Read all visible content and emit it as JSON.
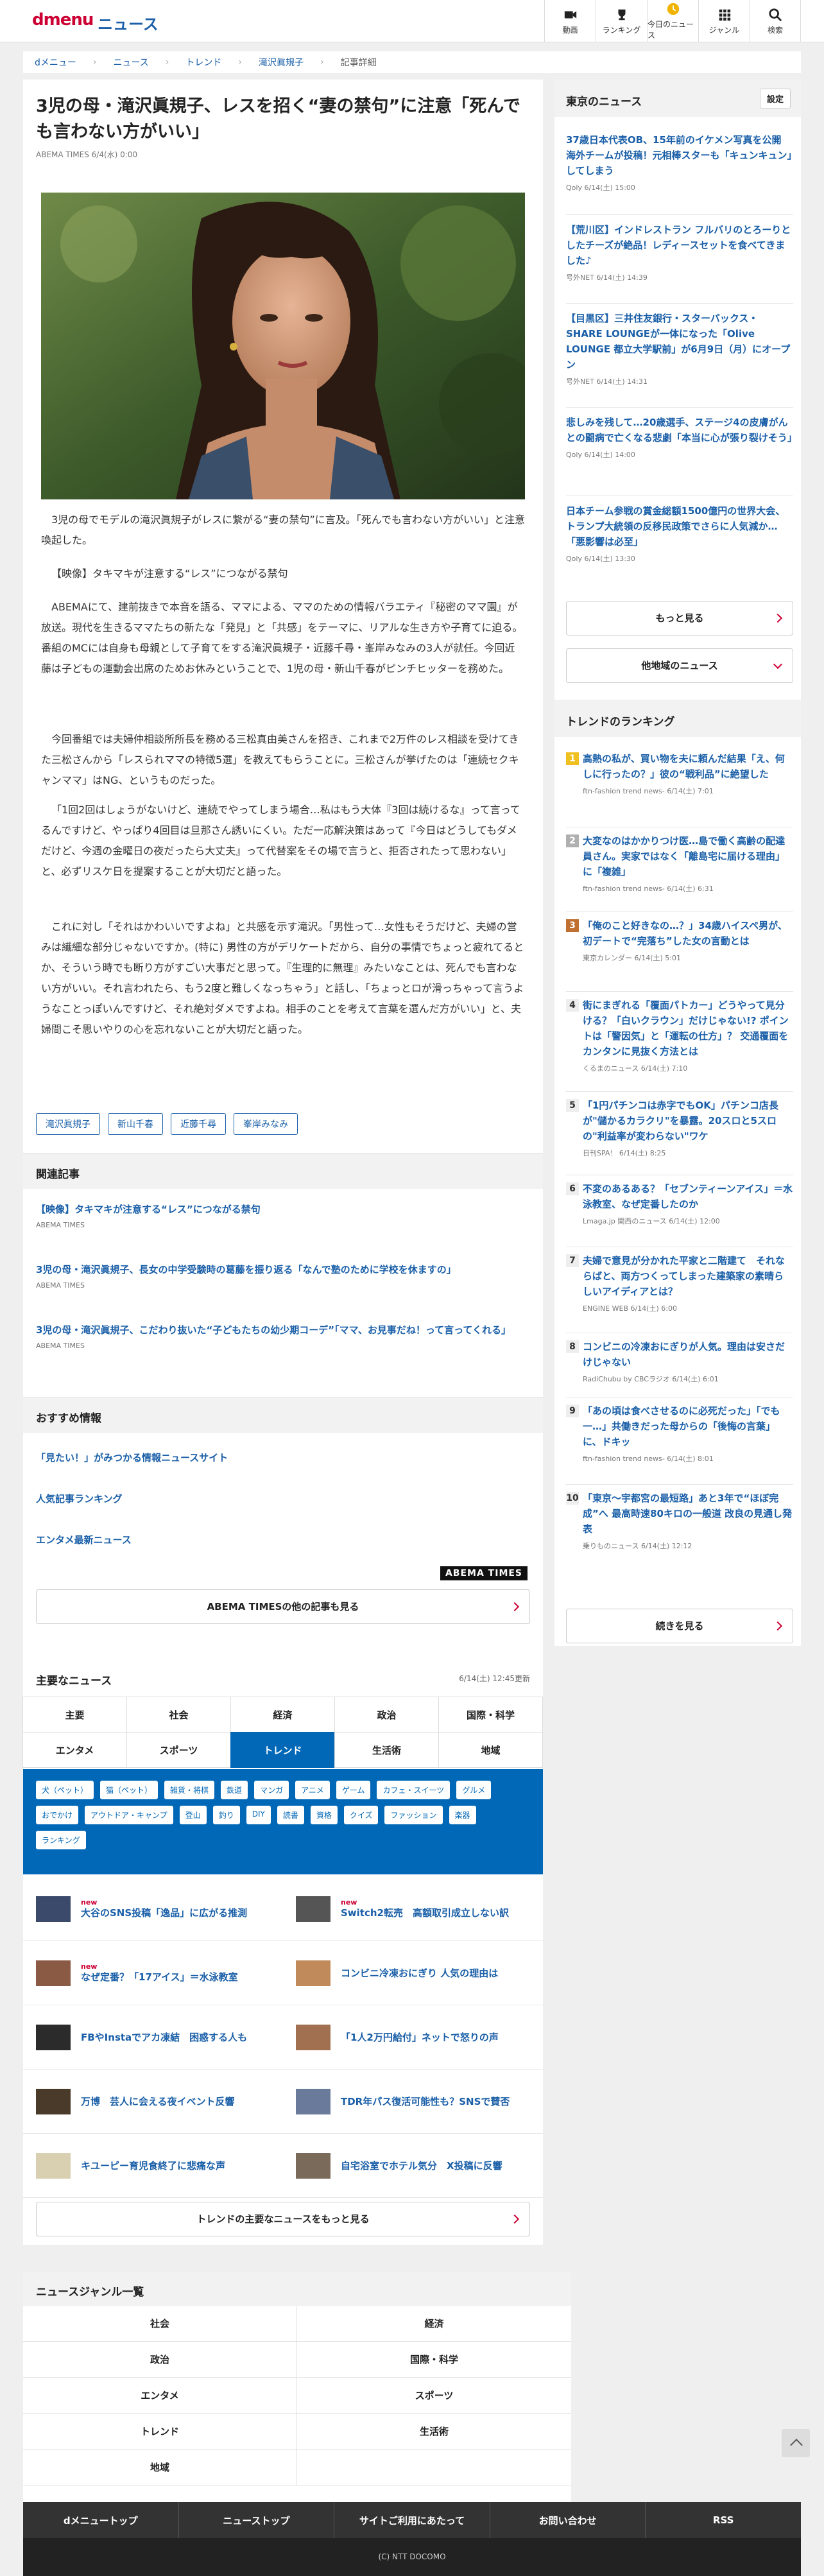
{
  "header": {
    "logo": "dmenu",
    "section": "ニュース",
    "nav": [
      {
        "label": "動画",
        "icon": "video-icon"
      },
      {
        "label": "ランキング",
        "icon": "trophy-icon"
      },
      {
        "label": "今日のニュース",
        "icon": "clock-icon"
      },
      {
        "label": "ジャンル",
        "icon": "grid-icon"
      },
      {
        "label": "検索",
        "icon": "search-icon"
      }
    ]
  },
  "breadcrumb": [
    "dメニュー",
    "ニュース",
    "トレンド",
    "滝沢眞規子",
    "記事詳細"
  ],
  "article": {
    "title": "3児の母・滝沢眞規子、レスを招く“妻の禁句”に注意「死んでも言わない方がいい」",
    "byline": "ABEMA TIMES 6/4(水) 0:00",
    "paragraphs": [
      "3児の母でモデルの滝沢眞規子がレスに繋がる“妻の禁句”に言及。「死んでも言わない方がいい」と注意喚起した。",
      "【映像】タキマキが注意する“レス”につながる禁句",
      "ABEMAにて、建前抜きで本音を語る、ママによる、ママのための情報バラエティ『秘密のママ園』が放送。現代を生きるママたちの新たな「発見」と「共感」をテーマに、リアルな生き方や子育てに迫る。番組のMCには自身も母親として子育てをする滝沢眞規子・近藤千尋・峯岸みなみの3人が就任。今回近藤は子どもの運動会出席のためお休みということで、1児の母・新山千春がピンチヒッターを務めた。",
      "今回番組では夫婦仲相談所所長を務める三松真由美さんを招き、これまで2万件のレス相談を受けてきた三松さんから「レスられママの特徴5選」を教えてもらうことに。三松さんが挙げたのは「連続セクキャンママ」はNG、というものだった。",
      "「1回2回はしょうがないけど、連続でやってしまう場合…私はもう大体『3回は続けるな』って言ってるんですけど、やっぱり4回目は旦那さん誘いにくい。ただ一応解決策はあって『今日はどうしてもダメだけど、今週の金曜日の夜だったら大丈夫』って代替案をその場で言うと、拒否されたって思わない」と、必ずリスケ日を提案することが大切だと語った。",
      "これに対し「それはかわいいですよね」と共感を示す滝沢。「男性って…女性もそうだけど、夫婦の営みは繊細な部分じゃないですか。(特に) 男性の方がデリケートだから、自分の事情でちょっと疲れてるとか、そういう時でも断り方がすごい大事だと思って。『生理的に無理』みたいなことは、死んでも言わない方がいい。それ言われたら、もう2度と難しくなっちゃう」と話し、「ちょっとロが滑っちゃって言うようなことっぽいんですけど、それ絶対ダメですよね。相手のことを考えて言葉を選んだ方がいい」と、夫婦間こそ思いやりの心を忘れないことが大切だと語った。"
    ],
    "tags": [
      "滝沢眞規子",
      "新山千春",
      "近藤千尋",
      "峯岸みなみ"
    ]
  },
  "related": {
    "heading": "関連記事",
    "items": [
      {
        "title": "【映像】タキマキが注意する“レス”につながる禁句",
        "source": "ABEMA TIMES"
      },
      {
        "title": "3児の母・滝沢眞規子、長女の中学受験時の葛藤を振り返る「なんで塾のために学校を休ますの」",
        "source": "ABEMA TIMES"
      },
      {
        "title": "3児の母・滝沢眞規子、こだわり抜いた“子どもたちの幼少期コーデ”「ママ、お見事だね！って言ってくれる」",
        "source": "ABEMA TIMES"
      }
    ]
  },
  "recommend": {
    "heading": "おすすめ情報",
    "items": [
      "「見たい！」がみつかる情報ニュースサイト",
      "人気記事ランキング",
      "エンタメ最新ニュース"
    ],
    "abema_logo": "ABEMA TIMES",
    "more_label": "ABEMA TIMESの他の記事も見る"
  },
  "major_news": {
    "heading": "主要なニュース",
    "updated": "6/14(土) 12:45更新",
    "tabs": [
      "主要",
      "社会",
      "経済",
      "政治",
      "国際・科学",
      "エンタメ",
      "スポーツ",
      "トレンド",
      "生活術",
      "地域"
    ],
    "active_tab": "トレンド",
    "keywords": [
      "犬（ペット）",
      "猫（ペット）",
      "雑貨・将棋",
      "鉄道",
      "マンガ",
      "アニメ",
      "ゲーム",
      "カフェ・スイーツ",
      "グルメ",
      "おでかけ",
      "アウトドア・キャンプ",
      "登山",
      "釣り",
      "DIY",
      "読書",
      "資格",
      "クイズ",
      "ファッション",
      "楽器",
      "ランキング"
    ],
    "items": [
      {
        "title": "大谷のSNS投稿「逸品」に広がる推測",
        "new": "new",
        "color": "#3b4a6b"
      },
      {
        "title": "Switch2転売　高額取引成立しない訳",
        "new": "new",
        "color": "#555555"
      },
      {
        "title": "なぜ定番？「17アイス」＝水泳教室",
        "new": "new",
        "color": "#8a5a44"
      },
      {
        "title": "コンビニ冷凍おにぎり 人気の理由は",
        "new": "",
        "color": "#c08a5a"
      },
      {
        "title": "FBやInstaでアカ凍結　困惑する人も",
        "new": "",
        "color": "#2b2b2b"
      },
      {
        "title": "「1人2万円給付」ネットで怒りの声",
        "new": "",
        "color": "#a07050"
      },
      {
        "title": "万博　芸人に会える夜イベント反響",
        "new": "",
        "color": "#4a3a2a"
      },
      {
        "title": "TDR年パス復活可能性も？SNSで賛否",
        "new": "",
        "color": "#6a7a9a"
      },
      {
        "title": "キユーピー育児食終了に悲痛な声",
        "new": "",
        "color": "#d8d0b0"
      },
      {
        "title": "自宅浴室でホテル気分　X投稿に反響",
        "new": "",
        "color": "#7a6a5a"
      }
    ],
    "more_label": "トレンドの主要なニュースをもっと見る"
  },
  "genres": {
    "heading": "ニュースジャンル一覧",
    "items": [
      "社会",
      "経済",
      "政治",
      "国際・科学",
      "エンタメ",
      "スポーツ",
      "トレンド",
      "生活術",
      "地域",
      ""
    ]
  },
  "footer": {
    "nav": [
      "dメニュートップ",
      "ニューストップ",
      "サイトご利用にあたって",
      "お問い合わせ",
      "RSS"
    ],
    "copyright": "(C) NTT DOCOMO"
  },
  "sidebar": {
    "local": {
      "heading": "東京のニュース",
      "settings_label": "設定",
      "items": [
        {
          "title": "37歳日本代表OB、15年前のイケメン写真を公開 海外チームが投稿！元相棒スターも「キュンキュン」してしまう",
          "source": "Qoly 6/14(土) 15:00"
        },
        {
          "title": "【荒川区】インドレストラン フルバリのとろーりとしたチーズが絶品！レディースセットを食べてきました♪",
          "source": "号外NET 6/14(土) 14:39"
        },
        {
          "title": "【目黒区】三井住友銀行・スターバックス・SHARE LOUNGEが一体になった「Olive LOUNGE 都立大学駅前」が6月9日（月）にオープン",
          "source": "号外NET 6/14(土) 14:31"
        },
        {
          "title": "悲しみを残して…20歳選手、ステージ4の皮膚がんとの闘病で亡くなる悲劇「本当に心が張り裂けそう」",
          "source": "Qoly 6/14(土) 14:00"
        },
        {
          "title": "日本チーム参戦の賞金総額1500億円の世界大会、トランプ大統領の反移民政策でさらに人気減か…「悪影響は必至」",
          "source": "Qoly 6/14(土) 13:30"
        }
      ],
      "more_label": "もっと見る",
      "other_label": "他地域のニュース"
    },
    "ranking": {
      "heading": "トレンドのランキング",
      "items": [
        {
          "rank": "1",
          "title": "高熱の私が、買い物を夫に頼んだ結果「え、何しに行ったの？」彼の“戦利品”に絶望した",
          "source": "ftn-fashion trend news- 6/14(土) 7:01",
          "color": "#f0c020"
        },
        {
          "rank": "2",
          "title": "大変なのはかかりつけ医…島で働く高齢の配達員さん。実家ではなく「離島宅に届ける理由」に「複雑」",
          "source": "ftn-fashion trend news- 6/14(土) 6:31",
          "color": "#b0b0b0"
        },
        {
          "rank": "3",
          "title": "「俺のこと好きなの…？」34歳ハイスペ男が、初デートで“完落ち”した女の言動とは",
          "source": "東京カレンダー 6/14(土) 5:01",
          "color": "#c07030"
        },
        {
          "rank": "4",
          "title": "街にまぎれる「覆面パトカー」どうやって見分ける？「白いクラウン」だけじゃない!? ポイントは「警因気」と「運転の仕方」？ 交通覆面をカンタンに見抜く方法とは",
          "source": "くるまのニュース 6/14(土) 7:10",
          "color": "#eeeeee"
        },
        {
          "rank": "5",
          "title": "「1円パチンコは赤字でもOK」パチンコ店長が\"儲かるカラクリ\"を暴露。20スロと5スロの\"利益率が変わらない\"ワケ",
          "source": "日刊SPA！ 6/14(土) 8:25",
          "color": "#eeeeee"
        },
        {
          "rank": "6",
          "title": "不変のあるある？「セブンティーンアイス」＝水泳教室、なぜ定番したのか",
          "source": "Lmaga.jp 関西のニュース 6/14(土) 12:00",
          "color": "#eeeeee"
        },
        {
          "rank": "7",
          "title": "夫婦で意見が分かれた平家と二階建て　それならばと、両方つくってしまった建築家の素晴らしいアイディアとは？",
          "source": "ENGINE WEB 6/14(土) 6:00",
          "color": "#eeeeee"
        },
        {
          "rank": "8",
          "title": "コンビニの冷凍おにぎりが人気。理由は安さだけじゃない",
          "source": "RadiChubu by CBCラジオ 6/14(土) 6:01",
          "color": "#eeeeee"
        },
        {
          "rank": "9",
          "title": "「あの頃は食べさせるのに必死だった」「でも一…」共働きだった母からの「後悔の言葉」に、ドキッ",
          "source": "ftn-fashion trend news- 6/14(土) 8:01",
          "color": "#eeeeee"
        },
        {
          "rank": "10",
          "title": "「東京～宇都宮の最短路」あと3年で“ほぼ完成”へ 最高時速80キロの一般道 改良の見通し発表",
          "source": "乗りものニュース 6/14(土) 12:12",
          "color": "#eeeeee"
        }
      ],
      "more_label": "続きを見る"
    }
  }
}
